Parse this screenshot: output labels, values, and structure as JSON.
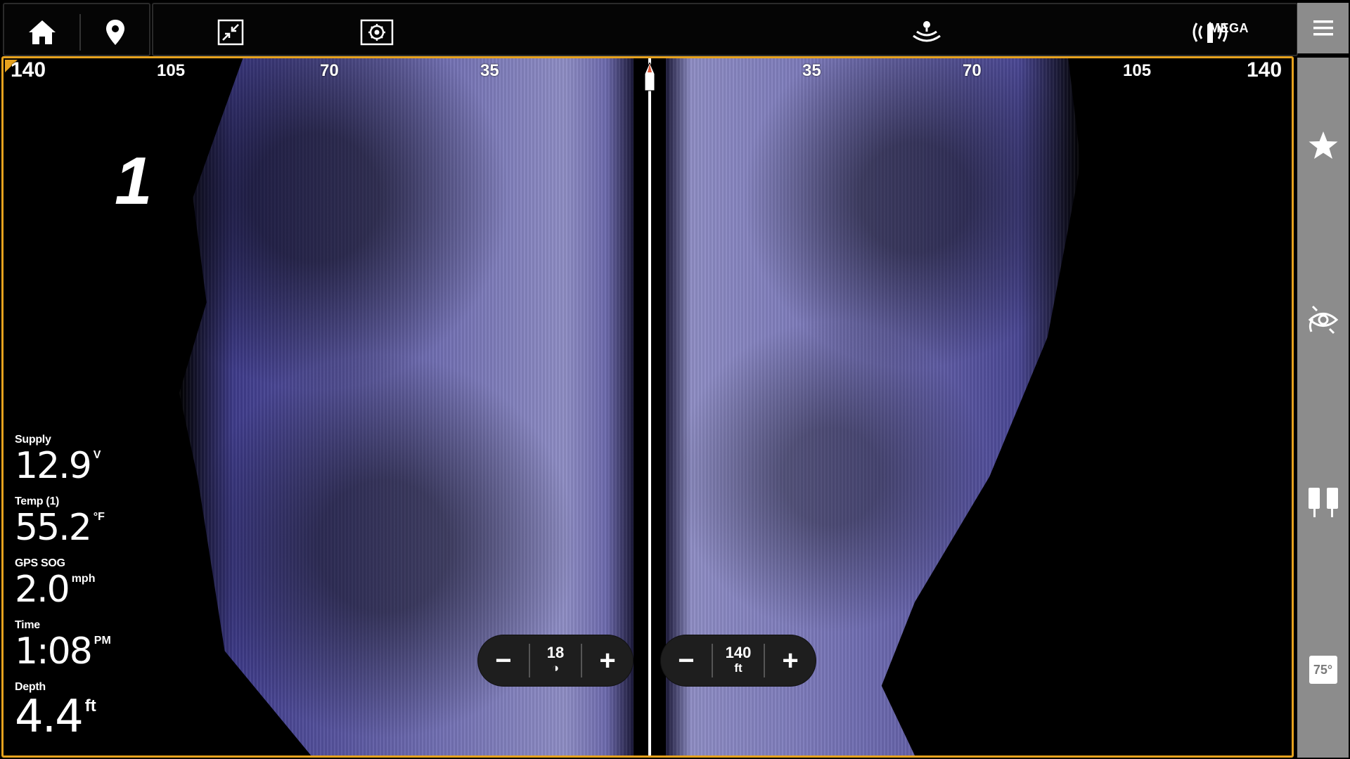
{
  "topbar": {
    "icons": [
      "home-icon",
      "waypoint-icon",
      "collapse-view-icon",
      "settings-icon",
      "sonar-icon",
      "radio-broadcast-icon",
      "hamburger-menu-icon"
    ],
    "mode_label": "MEGA"
  },
  "view": {
    "pane_number": "1",
    "range_scale_left": [
      "140",
      "105",
      "70",
      "35"
    ],
    "range_scale_right": [
      "35",
      "70",
      "105",
      "140"
    ],
    "sonar_color": "#7472b4",
    "border_color": "#e6a21e"
  },
  "readouts": [
    {
      "label": "Supply",
      "value": "12.9",
      "unit": "V"
    },
    {
      "label": "Temp (1)",
      "value": "55.2",
      "unit": "°F"
    },
    {
      "label": "GPS SOG",
      "value": "2.0",
      "unit": "mph"
    },
    {
      "label": "Time",
      "value": "1:08",
      "unit": "PM"
    },
    {
      "label": "Depth",
      "value": "4.4",
      "unit": "ft"
    }
  ],
  "zoom_controls": {
    "chart_speed": {
      "value": "18",
      "minus": "−",
      "plus": "+"
    },
    "range": {
      "value": "140",
      "unit": "ft",
      "minus": "−",
      "plus": "+"
    }
  },
  "rail": {
    "icons": [
      "favorite-star-icon",
      "sonar-eye-icon",
      "transducer-icon"
    ],
    "water_temp": "75°"
  }
}
